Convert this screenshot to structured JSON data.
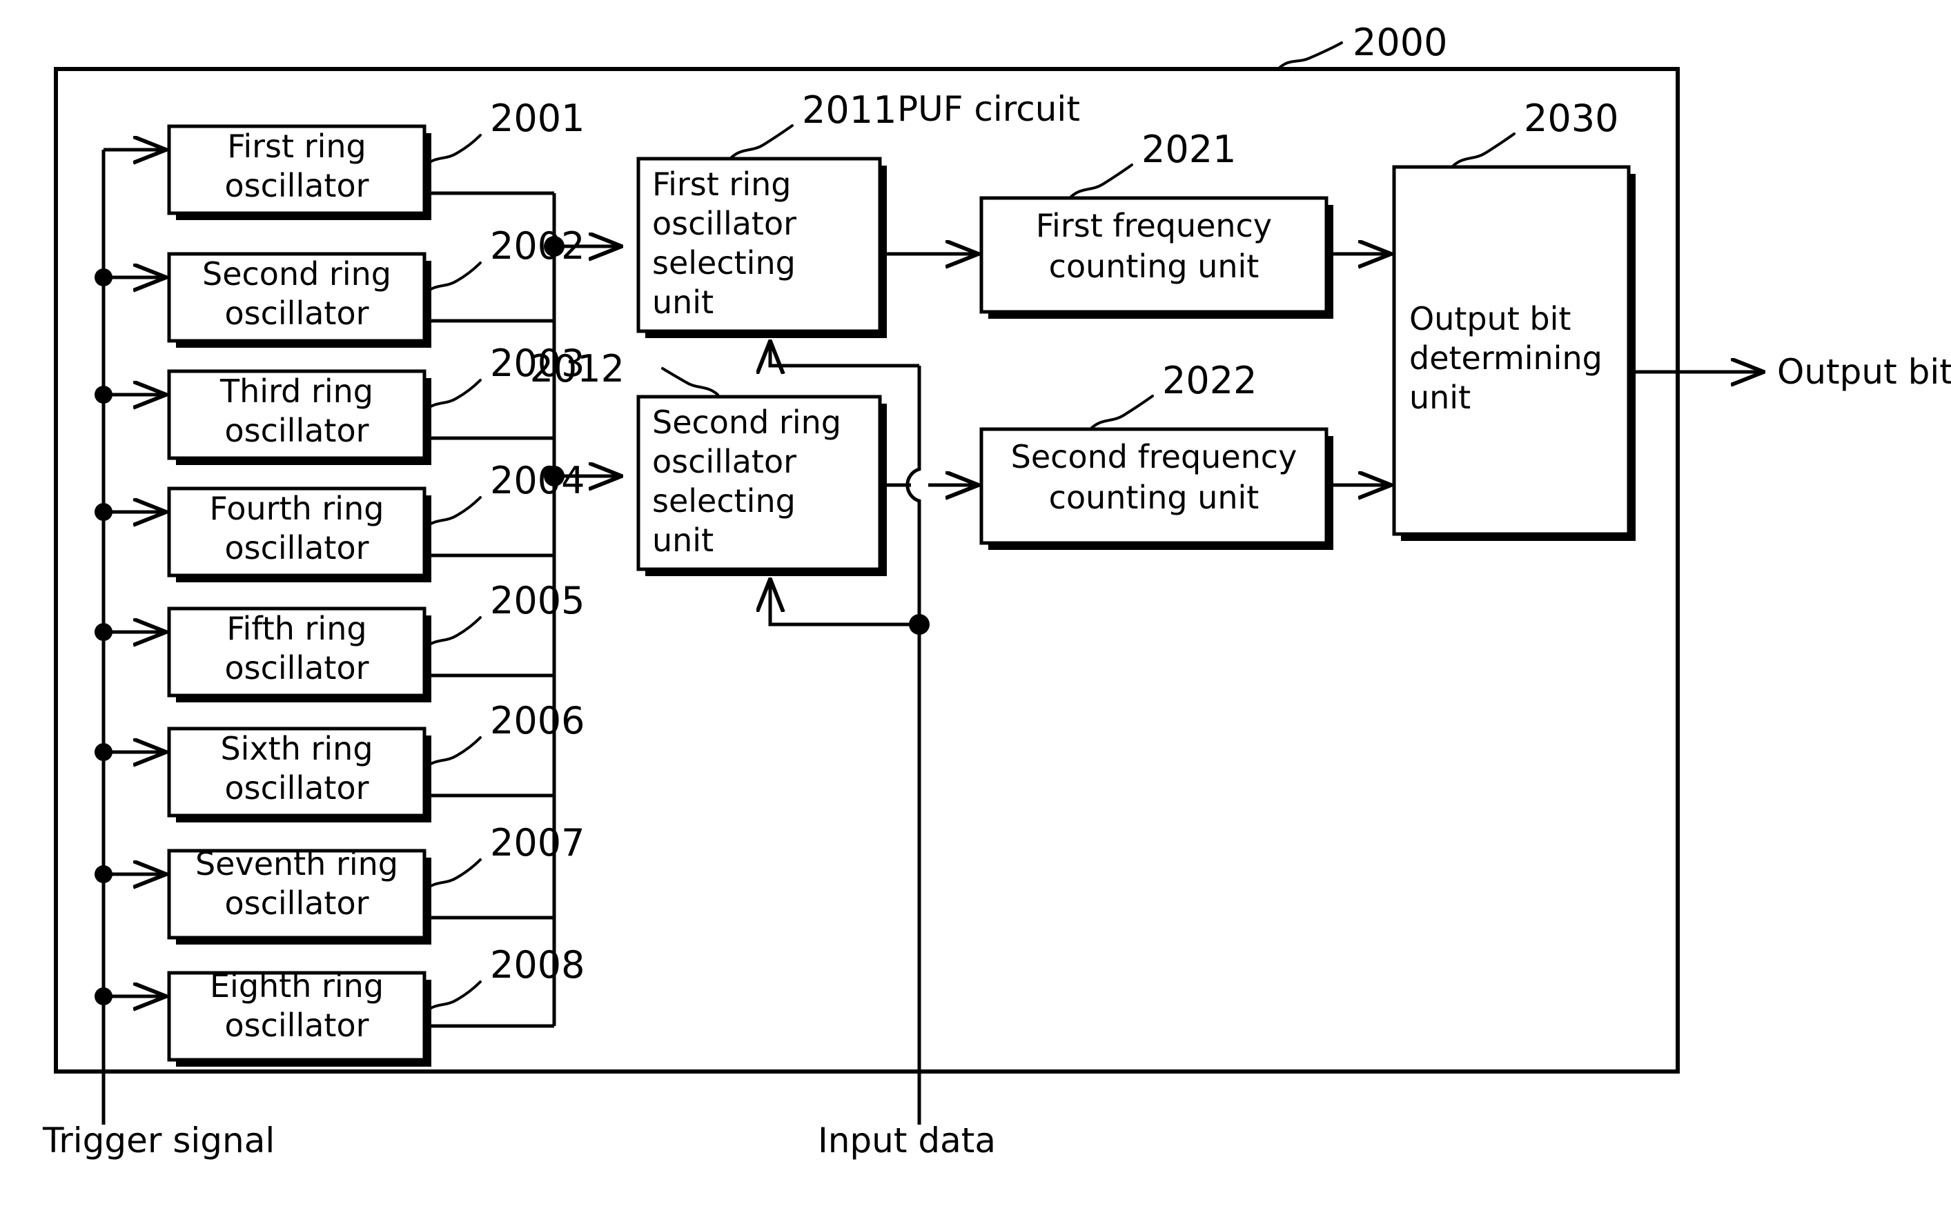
{
  "figure": {
    "title_label": "PUF circuit",
    "outer_ref": "2000",
    "output_port_label": "Output bit",
    "trigger_label": "Trigger signal",
    "input_label": "Input data"
  },
  "oscillators": [
    {
      "ref": "2001",
      "line1": "First ring",
      "line2": "oscillator"
    },
    {
      "ref": "2002",
      "line1": "Second ring",
      "line2": "oscillator"
    },
    {
      "ref": "2003",
      "line1": "Third ring",
      "line2": "oscillator"
    },
    {
      "ref": "2004",
      "line1": "Fourth ring",
      "line2": "oscillator"
    },
    {
      "ref": "2005",
      "line1": "Fifth ring",
      "line2": "oscillator"
    },
    {
      "ref": "2006",
      "line1": "Sixth ring",
      "line2": "oscillator"
    },
    {
      "ref": "2007",
      "line1": "Seventh ring",
      "line2": "oscillator"
    },
    {
      "ref": "2008",
      "line1": "Eighth ring",
      "line2": "oscillator"
    }
  ],
  "selecting_units": [
    {
      "ref": "2011",
      "line1": "First ring",
      "line2": "oscillator",
      "line3": "selecting",
      "line4": "unit"
    },
    {
      "ref": "2012",
      "line1": "Second ring",
      "line2": "oscillator",
      "line3": "selecting",
      "line4": "unit"
    }
  ],
  "counting_units": [
    {
      "ref": "2021",
      "line1": "First frequency",
      "line2": "counting unit"
    },
    {
      "ref": "2022",
      "line1": "Second frequency",
      "line2": "counting unit"
    }
  ],
  "output_unit": {
    "ref": "2030",
    "line1": "Output bit",
    "line2": "determining",
    "line3": "unit"
  },
  "colors": {
    "ink": "#000000",
    "paper": "#ffffff"
  }
}
